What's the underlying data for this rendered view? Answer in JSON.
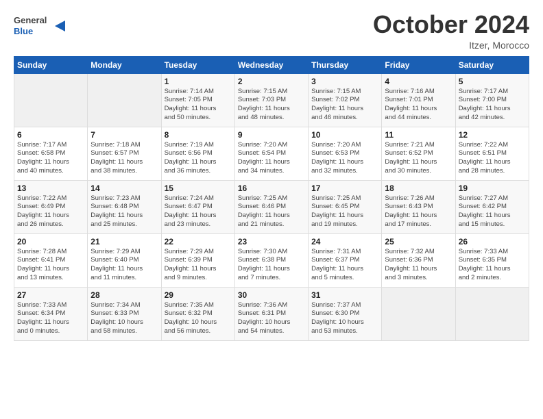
{
  "header": {
    "logo_general": "General",
    "logo_blue": "Blue",
    "month_title": "October 2024",
    "location": "Itzer, Morocco"
  },
  "columns": [
    "Sunday",
    "Monday",
    "Tuesday",
    "Wednesday",
    "Thursday",
    "Friday",
    "Saturday"
  ],
  "weeks": [
    [
      {
        "day": "",
        "info": ""
      },
      {
        "day": "",
        "info": ""
      },
      {
        "day": "1",
        "info": "Sunrise: 7:14 AM\nSunset: 7:05 PM\nDaylight: 11 hours\nand 50 minutes."
      },
      {
        "day": "2",
        "info": "Sunrise: 7:15 AM\nSunset: 7:03 PM\nDaylight: 11 hours\nand 48 minutes."
      },
      {
        "day": "3",
        "info": "Sunrise: 7:15 AM\nSunset: 7:02 PM\nDaylight: 11 hours\nand 46 minutes."
      },
      {
        "day": "4",
        "info": "Sunrise: 7:16 AM\nSunset: 7:01 PM\nDaylight: 11 hours\nand 44 minutes."
      },
      {
        "day": "5",
        "info": "Sunrise: 7:17 AM\nSunset: 7:00 PM\nDaylight: 11 hours\nand 42 minutes."
      }
    ],
    [
      {
        "day": "6",
        "info": "Sunrise: 7:17 AM\nSunset: 6:58 PM\nDaylight: 11 hours\nand 40 minutes."
      },
      {
        "day": "7",
        "info": "Sunrise: 7:18 AM\nSunset: 6:57 PM\nDaylight: 11 hours\nand 38 minutes."
      },
      {
        "day": "8",
        "info": "Sunrise: 7:19 AM\nSunset: 6:56 PM\nDaylight: 11 hours\nand 36 minutes."
      },
      {
        "day": "9",
        "info": "Sunrise: 7:20 AM\nSunset: 6:54 PM\nDaylight: 11 hours\nand 34 minutes."
      },
      {
        "day": "10",
        "info": "Sunrise: 7:20 AM\nSunset: 6:53 PM\nDaylight: 11 hours\nand 32 minutes."
      },
      {
        "day": "11",
        "info": "Sunrise: 7:21 AM\nSunset: 6:52 PM\nDaylight: 11 hours\nand 30 minutes."
      },
      {
        "day": "12",
        "info": "Sunrise: 7:22 AM\nSunset: 6:51 PM\nDaylight: 11 hours\nand 28 minutes."
      }
    ],
    [
      {
        "day": "13",
        "info": "Sunrise: 7:22 AM\nSunset: 6:49 PM\nDaylight: 11 hours\nand 26 minutes."
      },
      {
        "day": "14",
        "info": "Sunrise: 7:23 AM\nSunset: 6:48 PM\nDaylight: 11 hours\nand 25 minutes."
      },
      {
        "day": "15",
        "info": "Sunrise: 7:24 AM\nSunset: 6:47 PM\nDaylight: 11 hours\nand 23 minutes."
      },
      {
        "day": "16",
        "info": "Sunrise: 7:25 AM\nSunset: 6:46 PM\nDaylight: 11 hours\nand 21 minutes."
      },
      {
        "day": "17",
        "info": "Sunrise: 7:25 AM\nSunset: 6:45 PM\nDaylight: 11 hours\nand 19 minutes."
      },
      {
        "day": "18",
        "info": "Sunrise: 7:26 AM\nSunset: 6:43 PM\nDaylight: 11 hours\nand 17 minutes."
      },
      {
        "day": "19",
        "info": "Sunrise: 7:27 AM\nSunset: 6:42 PM\nDaylight: 11 hours\nand 15 minutes."
      }
    ],
    [
      {
        "day": "20",
        "info": "Sunrise: 7:28 AM\nSunset: 6:41 PM\nDaylight: 11 hours\nand 13 minutes."
      },
      {
        "day": "21",
        "info": "Sunrise: 7:29 AM\nSunset: 6:40 PM\nDaylight: 11 hours\nand 11 minutes."
      },
      {
        "day": "22",
        "info": "Sunrise: 7:29 AM\nSunset: 6:39 PM\nDaylight: 11 hours\nand 9 minutes."
      },
      {
        "day": "23",
        "info": "Sunrise: 7:30 AM\nSunset: 6:38 PM\nDaylight: 11 hours\nand 7 minutes."
      },
      {
        "day": "24",
        "info": "Sunrise: 7:31 AM\nSunset: 6:37 PM\nDaylight: 11 hours\nand 5 minutes."
      },
      {
        "day": "25",
        "info": "Sunrise: 7:32 AM\nSunset: 6:36 PM\nDaylight: 11 hours\nand 3 minutes."
      },
      {
        "day": "26",
        "info": "Sunrise: 7:33 AM\nSunset: 6:35 PM\nDaylight: 11 hours\nand 2 minutes."
      }
    ],
    [
      {
        "day": "27",
        "info": "Sunrise: 7:33 AM\nSunset: 6:34 PM\nDaylight: 11 hours\nand 0 minutes."
      },
      {
        "day": "28",
        "info": "Sunrise: 7:34 AM\nSunset: 6:33 PM\nDaylight: 10 hours\nand 58 minutes."
      },
      {
        "day": "29",
        "info": "Sunrise: 7:35 AM\nSunset: 6:32 PM\nDaylight: 10 hours\nand 56 minutes."
      },
      {
        "day": "30",
        "info": "Sunrise: 7:36 AM\nSunset: 6:31 PM\nDaylight: 10 hours\nand 54 minutes."
      },
      {
        "day": "31",
        "info": "Sunrise: 7:37 AM\nSunset: 6:30 PM\nDaylight: 10 hours\nand 53 minutes."
      },
      {
        "day": "",
        "info": ""
      },
      {
        "day": "",
        "info": ""
      }
    ]
  ]
}
